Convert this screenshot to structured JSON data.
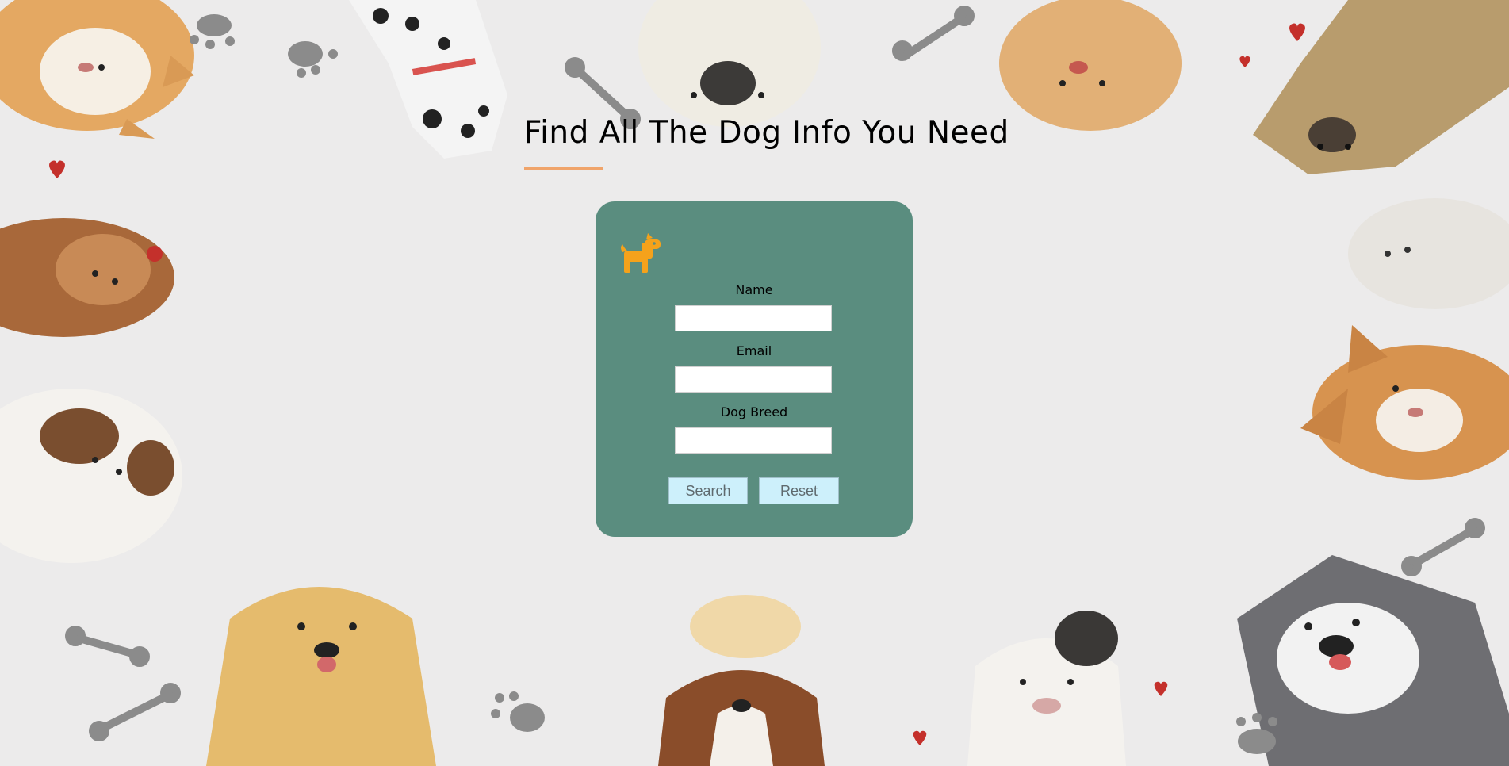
{
  "page": {
    "title": "Find All The Dog Info You Need"
  },
  "form": {
    "icon": "dog-icon",
    "fields": [
      {
        "label": "Name",
        "value": "",
        "placeholder": ""
      },
      {
        "label": "Email",
        "value": "",
        "placeholder": ""
      },
      {
        "label": "Dog Breed",
        "value": "",
        "placeholder": ""
      }
    ],
    "buttons": {
      "search_label": "Search",
      "reset_label": "Reset"
    }
  },
  "colors": {
    "background": "#ecebeb",
    "card": "#5a8d7f",
    "accent_underline": "#f0a46a",
    "button_bg": "#cdf0fb",
    "dog_icon": "#f5a21b"
  },
  "background_decorations": [
    "dog-illustration",
    "paw-print-icon",
    "bone-icon",
    "heart-icon"
  ]
}
